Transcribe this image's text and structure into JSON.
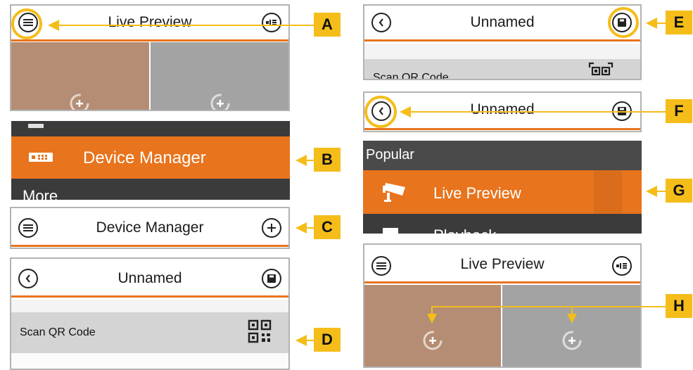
{
  "panels": {
    "a": {
      "title": "Live Preview"
    },
    "b": {
      "item_label": "Device Manager",
      "top_label": "...",
      "bottom_label": "More"
    },
    "c": {
      "title": "Device Manager"
    },
    "d": {
      "title": "Unnamed",
      "row_label": "Scan QR Code"
    },
    "e": {
      "title": "Unnamed",
      "row_label": "Scan QR Code"
    },
    "f": {
      "title": "Unnamed"
    },
    "g": {
      "section": "Popular",
      "item_label": "Live Preview",
      "bottom_label": "Playback"
    },
    "h": {
      "title": "Live Preview"
    }
  },
  "callouts": [
    "A",
    "B",
    "C",
    "D",
    "E",
    "F",
    "G",
    "H"
  ],
  "icons": {
    "menu": "hamburger-circle-icon",
    "back": "chevron-left-circle-icon",
    "save": "floppy-disk-circle-icon",
    "add": "plus-circle-icon",
    "preview": "camera-list-circle-icon",
    "qr": "qr-code-icon",
    "device": "dvr-device-icon",
    "camera": "cctv-camera-icon"
  },
  "colors": {
    "accent": "#e8741d",
    "callout": "#f5bd1a",
    "dark_menu": "#3b3b3b",
    "tile_brown": "#b48d74",
    "tile_gray": "#a3a3a3"
  }
}
